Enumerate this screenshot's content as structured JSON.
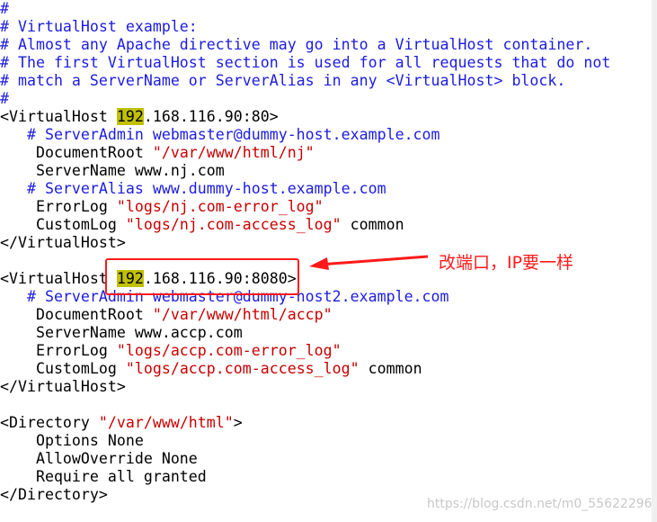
{
  "colors": {
    "comment": "#1c1ce0",
    "string": "#c80000",
    "highlight": "#c0c000",
    "annotation": "#ff1a1a"
  },
  "lines": [
    [
      [
        "#",
        "c"
      ]
    ],
    [
      [
        "# VirtualHost example:",
        "c"
      ]
    ],
    [
      [
        "# Almost any Apache directive may go into a VirtualHost container.",
        "c"
      ]
    ],
    [
      [
        "# The first VirtualHost section is used for all requests that do not",
        "c"
      ]
    ],
    [
      [
        "# match a ServerName or ServerAlias in any <VirtualHost> block.",
        "c"
      ]
    ],
    [
      [
        "#",
        "c"
      ]
    ],
    [
      [
        "<VirtualHost ",
        ""
      ],
      [
        "192",
        "h"
      ],
      [
        ".168.116.90:80>",
        ""
      ]
    ],
    [
      [
        "   # ServerAdmin webmaster@dummy-host.example.com",
        "c"
      ]
    ],
    [
      [
        "    DocumentRoot ",
        ""
      ],
      [
        "\"/var/www/html/nj\"",
        "s"
      ]
    ],
    [
      [
        "    ServerName www.nj.com",
        ""
      ]
    ],
    [
      [
        "   # ServerAlias www.dummy-host.example.com",
        "c"
      ]
    ],
    [
      [
        "    ErrorLog ",
        ""
      ],
      [
        "\"logs/nj.com-error_log\"",
        "s"
      ]
    ],
    [
      [
        "    CustomLog ",
        ""
      ],
      [
        "\"logs/nj.com-access_log\"",
        "s"
      ],
      [
        " common",
        ""
      ]
    ],
    [
      [
        "</VirtualHost>",
        ""
      ]
    ],
    [
      [
        "",
        ""
      ]
    ],
    [
      [
        "<VirtualHost ",
        ""
      ],
      [
        "192",
        "h"
      ],
      [
        ".168.116.90:8080>",
        ""
      ]
    ],
    [
      [
        "   # ServerAdmin webmaster@dummy-host2.example.com",
        "c"
      ]
    ],
    [
      [
        "    DocumentRoot ",
        ""
      ],
      [
        "\"/var/www/html/accp\"",
        "s"
      ]
    ],
    [
      [
        "    ServerName www.accp.com",
        ""
      ]
    ],
    [
      [
        "    ErrorLog ",
        ""
      ],
      [
        "\"logs/accp.com-error_log\"",
        "s"
      ]
    ],
    [
      [
        "    CustomLog ",
        ""
      ],
      [
        "\"logs/accp.com-access_log\"",
        "s"
      ],
      [
        " common",
        ""
      ]
    ],
    [
      [
        "</VirtualHost>",
        ""
      ]
    ],
    [
      [
        "",
        ""
      ]
    ],
    [
      [
        "<Directory ",
        ""
      ],
      [
        "\"/var/www/html\"",
        "s"
      ],
      [
        ">",
        ""
      ]
    ],
    [
      [
        "    Options None",
        ""
      ]
    ],
    [
      [
        "    AllowOverride None",
        ""
      ]
    ],
    [
      [
        "    Require all granted",
        ""
      ]
    ],
    [
      [
        "</Directory>",
        ""
      ]
    ]
  ],
  "annotation": {
    "note": "改端口，IP要一样"
  },
  "watermark": "https://blog.csdn.net/m0_55622296"
}
